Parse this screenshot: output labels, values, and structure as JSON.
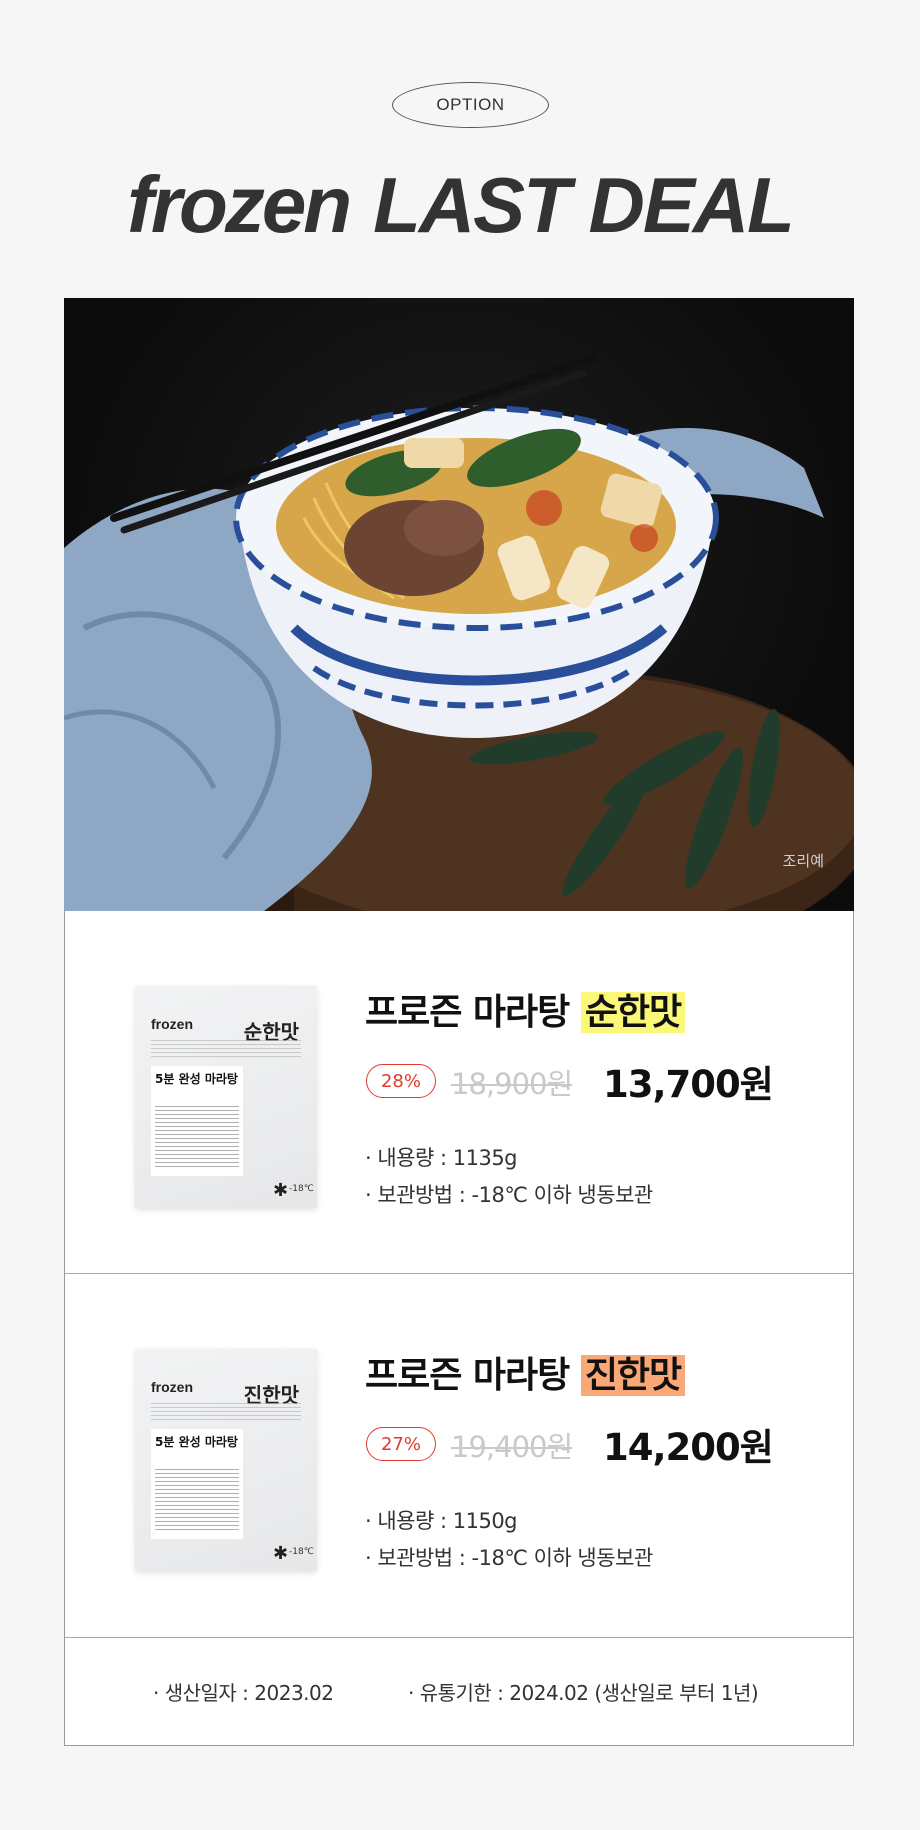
{
  "header": {
    "option_label": "OPTION",
    "title_part1": "frozen",
    "title_part2": "LAST DEAL"
  },
  "hero": {
    "caption": "조리예"
  },
  "products": [
    {
      "title": "프로즌 마라탕",
      "flavor": "순한맛",
      "discount": "28%",
      "original_price": "18,900원",
      "price": "13,700원",
      "volume": "· 내용량 : 1135g",
      "storage": "· 보관방법 : -18℃ 이하 냉동보관",
      "package": {
        "brand": "frozen",
        "flavor": "순한맛",
        "label": "5분 완성 마라탕",
        "temp": "-18℃"
      }
    },
    {
      "title": "프로즌 마라탕",
      "flavor": "진한맛",
      "discount": "27%",
      "original_price": "19,400원",
      "price": "14,200원",
      "volume": "· 내용량 : 1150g",
      "storage": "· 보관방법 : -18℃ 이하 냉동보관",
      "package": {
        "brand": "frozen",
        "flavor": "진한맛",
        "label": "5분 완성 마라탕",
        "temp": "-18℃"
      }
    }
  ],
  "footer": {
    "production_date": "· 생산일자 : 2023.02",
    "expiry": "· 유통기한 : 2024.02 (생산일로 부터 1년)"
  },
  "colors": {
    "highlight_mild": "#fbf779",
    "highlight_strong": "#f9a878",
    "discount_red": "#e03a2f"
  }
}
